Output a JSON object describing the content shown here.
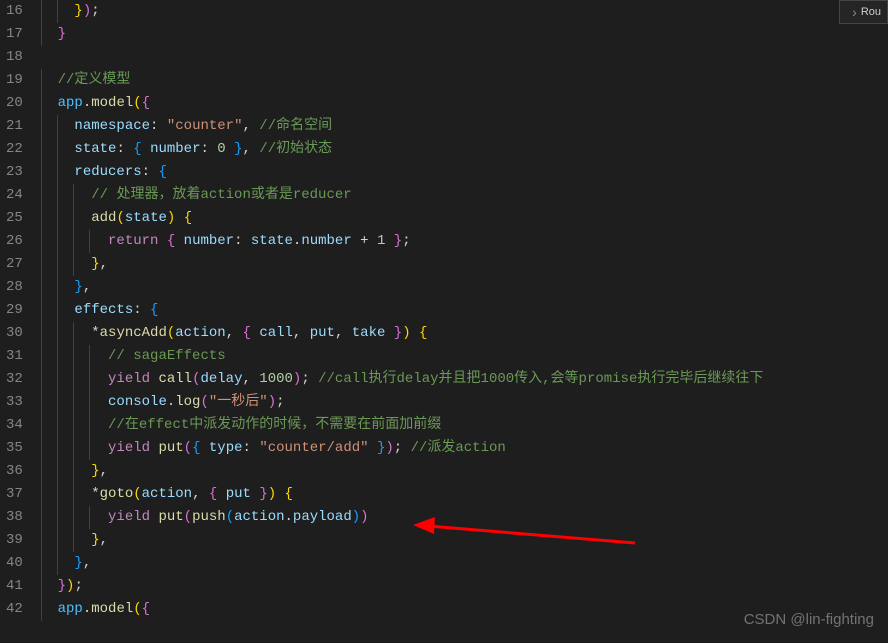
{
  "breadcrumb": {
    "chevron": "›",
    "label": "Rou"
  },
  "watermark": "CSDN @lin-fighting",
  "startLine": 16,
  "lineCount": 27,
  "code": {
    "l16": {
      "indents": 2,
      "tokens": [
        {
          "t": "brace-y",
          "v": "}"
        },
        {
          "t": "brace-p",
          "v": ")"
        },
        {
          "t": "punct",
          "v": ";"
        }
      ]
    },
    "l17": {
      "indents": 1,
      "tokens": [
        {
          "t": "brace-p",
          "v": "}"
        }
      ]
    },
    "l18": {
      "indents": 0,
      "tokens": []
    },
    "l19": {
      "indents": 1,
      "tokens": [
        {
          "t": "comment",
          "v": "//定义模型"
        }
      ]
    },
    "l20": {
      "indents": 1,
      "tokens": [
        {
          "t": "const",
          "v": "app"
        },
        {
          "t": "punct",
          "v": "."
        },
        {
          "t": "func",
          "v": "model"
        },
        {
          "t": "brace-y",
          "v": "("
        },
        {
          "t": "brace-p",
          "v": "{"
        }
      ]
    },
    "l21": {
      "indents": 2,
      "tokens": [
        {
          "t": "prop",
          "v": "namespace"
        },
        {
          "t": "punct",
          "v": ": "
        },
        {
          "t": "string",
          "v": "\"counter\""
        },
        {
          "t": "punct",
          "v": ", "
        },
        {
          "t": "comment",
          "v": "//命名空间"
        }
      ]
    },
    "l22": {
      "indents": 2,
      "tokens": [
        {
          "t": "prop",
          "v": "state"
        },
        {
          "t": "punct",
          "v": ": "
        },
        {
          "t": "brace-b",
          "v": "{"
        },
        {
          "t": "punct",
          "v": " "
        },
        {
          "t": "prop",
          "v": "number"
        },
        {
          "t": "punct",
          "v": ": "
        },
        {
          "t": "num",
          "v": "0"
        },
        {
          "t": "punct",
          "v": " "
        },
        {
          "t": "brace-b",
          "v": "}"
        },
        {
          "t": "punct",
          "v": ", "
        },
        {
          "t": "comment",
          "v": "//初始状态"
        }
      ]
    },
    "l23": {
      "indents": 2,
      "tokens": [
        {
          "t": "prop",
          "v": "reducers"
        },
        {
          "t": "punct",
          "v": ": "
        },
        {
          "t": "brace-b",
          "v": "{"
        }
      ]
    },
    "l24": {
      "indents": 3,
      "tokens": [
        {
          "t": "comment",
          "v": "// 处理器，放着action或者是reducer"
        }
      ]
    },
    "l25": {
      "indents": 3,
      "tokens": [
        {
          "t": "func",
          "v": "add"
        },
        {
          "t": "brace-y",
          "v": "("
        },
        {
          "t": "prop",
          "v": "state"
        },
        {
          "t": "brace-y",
          "v": ")"
        },
        {
          "t": "punct",
          "v": " "
        },
        {
          "t": "brace-y",
          "v": "{"
        }
      ]
    },
    "l26": {
      "indents": 4,
      "tokens": [
        {
          "t": "keyword",
          "v": "return"
        },
        {
          "t": "punct",
          "v": " "
        },
        {
          "t": "brace-p",
          "v": "{"
        },
        {
          "t": "punct",
          "v": " "
        },
        {
          "t": "prop",
          "v": "number"
        },
        {
          "t": "punct",
          "v": ": "
        },
        {
          "t": "prop",
          "v": "state"
        },
        {
          "t": "punct",
          "v": "."
        },
        {
          "t": "prop",
          "v": "number"
        },
        {
          "t": "punct",
          "v": " + "
        },
        {
          "t": "num",
          "v": "1"
        },
        {
          "t": "punct",
          "v": " "
        },
        {
          "t": "brace-p",
          "v": "}"
        },
        {
          "t": "punct",
          "v": ";"
        }
      ]
    },
    "l27": {
      "indents": 3,
      "tokens": [
        {
          "t": "brace-y",
          "v": "}"
        },
        {
          "t": "punct",
          "v": ","
        }
      ]
    },
    "l28": {
      "indents": 2,
      "tokens": [
        {
          "t": "brace-b",
          "v": "}"
        },
        {
          "t": "punct",
          "v": ","
        }
      ]
    },
    "l29": {
      "indents": 2,
      "tokens": [
        {
          "t": "prop",
          "v": "effects"
        },
        {
          "t": "punct",
          "v": ": "
        },
        {
          "t": "brace-b",
          "v": "{"
        }
      ]
    },
    "l30": {
      "indents": 3,
      "tokens": [
        {
          "t": "punct",
          "v": "*"
        },
        {
          "t": "func",
          "v": "asyncAdd"
        },
        {
          "t": "brace-y",
          "v": "("
        },
        {
          "t": "prop",
          "v": "action"
        },
        {
          "t": "punct",
          "v": ", "
        },
        {
          "t": "brace-p",
          "v": "{"
        },
        {
          "t": "punct",
          "v": " "
        },
        {
          "t": "prop",
          "v": "call"
        },
        {
          "t": "punct",
          "v": ", "
        },
        {
          "t": "prop",
          "v": "put"
        },
        {
          "t": "punct",
          "v": ", "
        },
        {
          "t": "prop",
          "v": "take"
        },
        {
          "t": "punct",
          "v": " "
        },
        {
          "t": "brace-p",
          "v": "}"
        },
        {
          "t": "brace-y",
          "v": ")"
        },
        {
          "t": "punct",
          "v": " "
        },
        {
          "t": "brace-y",
          "v": "{"
        }
      ]
    },
    "l31": {
      "indents": 4,
      "tokens": [
        {
          "t": "comment",
          "v": "// sagaEffects"
        }
      ]
    },
    "l32": {
      "indents": 4,
      "tokens": [
        {
          "t": "keyword",
          "v": "yield"
        },
        {
          "t": "punct",
          "v": " "
        },
        {
          "t": "func",
          "v": "call"
        },
        {
          "t": "brace-p",
          "v": "("
        },
        {
          "t": "prop",
          "v": "delay"
        },
        {
          "t": "punct",
          "v": ", "
        },
        {
          "t": "num",
          "v": "1000"
        },
        {
          "t": "brace-p",
          "v": ")"
        },
        {
          "t": "punct",
          "v": "; "
        },
        {
          "t": "comment",
          "v": "//call执行delay并且把1000传入,会等promise执行完毕后继续往下"
        }
      ]
    },
    "l33": {
      "indents": 4,
      "tokens": [
        {
          "t": "prop",
          "v": "console"
        },
        {
          "t": "punct",
          "v": "."
        },
        {
          "t": "func",
          "v": "log"
        },
        {
          "t": "brace-p",
          "v": "("
        },
        {
          "t": "string",
          "v": "\"一秒后\""
        },
        {
          "t": "brace-p",
          "v": ")"
        },
        {
          "t": "punct",
          "v": ";"
        }
      ]
    },
    "l34": {
      "indents": 4,
      "tokens": [
        {
          "t": "comment",
          "v": "//在effect中派发动作的时候，不需要在前面加前缀"
        }
      ]
    },
    "l35": {
      "indents": 4,
      "tokens": [
        {
          "t": "keyword",
          "v": "yield"
        },
        {
          "t": "punct",
          "v": " "
        },
        {
          "t": "func",
          "v": "put"
        },
        {
          "t": "brace-p",
          "v": "("
        },
        {
          "t": "brace-b",
          "v": "{"
        },
        {
          "t": "punct",
          "v": " "
        },
        {
          "t": "prop",
          "v": "type"
        },
        {
          "t": "punct",
          "v": ": "
        },
        {
          "t": "string",
          "v": "\"counter/add\""
        },
        {
          "t": "punct",
          "v": " "
        },
        {
          "t": "brace-b",
          "v": "}"
        },
        {
          "t": "brace-p",
          "v": ")"
        },
        {
          "t": "punct",
          "v": "; "
        },
        {
          "t": "comment",
          "v": "//派发action"
        }
      ]
    },
    "l36": {
      "indents": 3,
      "tokens": [
        {
          "t": "brace-y",
          "v": "}"
        },
        {
          "t": "punct",
          "v": ","
        }
      ]
    },
    "l37": {
      "indents": 3,
      "tokens": [
        {
          "t": "punct",
          "v": "*"
        },
        {
          "t": "func",
          "v": "goto"
        },
        {
          "t": "brace-y",
          "v": "("
        },
        {
          "t": "prop",
          "v": "action"
        },
        {
          "t": "punct",
          "v": ", "
        },
        {
          "t": "brace-p",
          "v": "{"
        },
        {
          "t": "punct",
          "v": " "
        },
        {
          "t": "prop",
          "v": "put"
        },
        {
          "t": "punct",
          "v": " "
        },
        {
          "t": "brace-p",
          "v": "}"
        },
        {
          "t": "brace-y",
          "v": ")"
        },
        {
          "t": "punct",
          "v": " "
        },
        {
          "t": "brace-y",
          "v": "{"
        }
      ]
    },
    "l38": {
      "indents": 4,
      "tokens": [
        {
          "t": "keyword",
          "v": "yield"
        },
        {
          "t": "punct",
          "v": " "
        },
        {
          "t": "func",
          "v": "put"
        },
        {
          "t": "brace-p",
          "v": "("
        },
        {
          "t": "func",
          "v": "push"
        },
        {
          "t": "brace-b",
          "v": "("
        },
        {
          "t": "prop",
          "v": "action"
        },
        {
          "t": "punct",
          "v": "."
        },
        {
          "t": "prop",
          "v": "payload"
        },
        {
          "t": "brace-b",
          "v": ")"
        },
        {
          "t": "brace-p",
          "v": ")"
        }
      ]
    },
    "l39": {
      "indents": 3,
      "tokens": [
        {
          "t": "brace-y",
          "v": "}"
        },
        {
          "t": "punct",
          "v": ","
        }
      ]
    },
    "l40": {
      "indents": 2,
      "tokens": [
        {
          "t": "brace-b",
          "v": "}"
        },
        {
          "t": "punct",
          "v": ","
        }
      ]
    },
    "l41": {
      "indents": 1,
      "tokens": [
        {
          "t": "brace-p",
          "v": "}"
        },
        {
          "t": "brace-y",
          "v": ")"
        },
        {
          "t": "punct",
          "v": ";"
        }
      ]
    },
    "l42": {
      "indents": 1,
      "tokens": [
        {
          "t": "const",
          "v": "app"
        },
        {
          "t": "punct",
          "v": "."
        },
        {
          "t": "func",
          "v": "model"
        },
        {
          "t": "brace-y",
          "v": "("
        },
        {
          "t": "brace-p",
          "v": "{"
        }
      ]
    }
  }
}
